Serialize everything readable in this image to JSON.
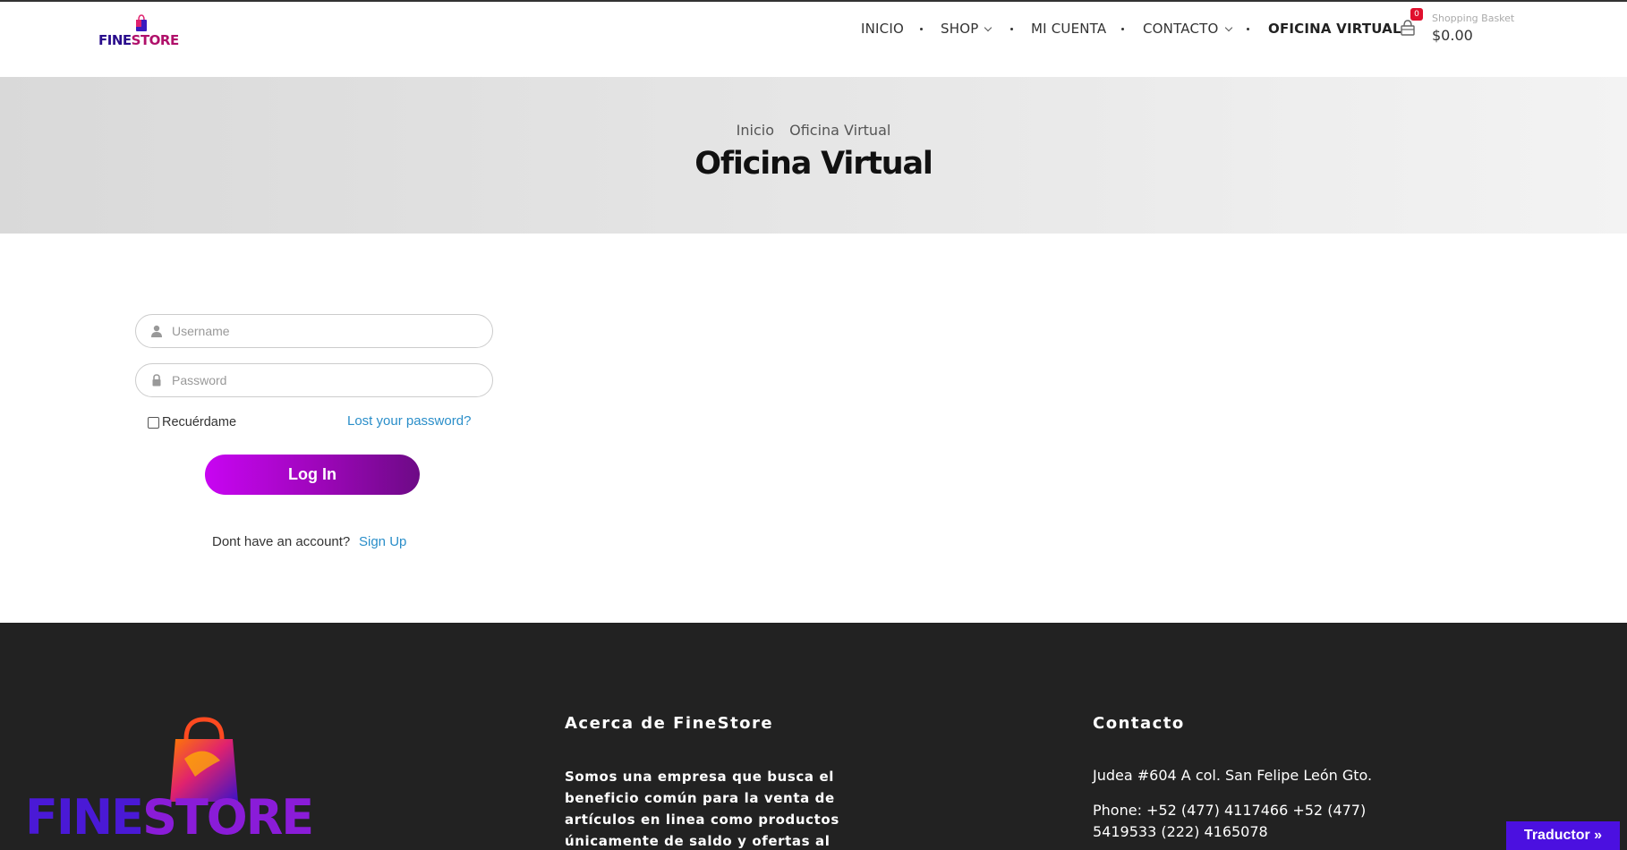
{
  "header": {
    "logo": {
      "word_fine": "FINE",
      "word_store": "STORE"
    },
    "nav": [
      {
        "label": "INICIO"
      },
      {
        "label": "SHOP"
      },
      {
        "label": "MI CUENTA"
      },
      {
        "label": "CONTACTO"
      },
      {
        "label": "OFICINA VIRTUAL"
      }
    ],
    "cart": {
      "count": "0",
      "label": "Shopping Basket",
      "amount": "$0.00",
      "icon": "shopping-basket-icon"
    }
  },
  "hero": {
    "breadcrumb": [
      "Inicio",
      "Oficina Virtual"
    ],
    "title": "Oficina Virtual"
  },
  "login": {
    "username_placeholder": "Username",
    "password_placeholder": "Password",
    "remember_label": "Recuérdame",
    "lost_password": "Lost your password?",
    "submit": "Log In",
    "no_account": "Dont have an account?",
    "signup": "Sign Up"
  },
  "footer": {
    "logo": {
      "word_fine": "FINE",
      "word_store": "STORE"
    },
    "about_heading": "Acerca de FineStore",
    "about_text": "Somos una empresa que busca el beneficio común para la venta de artículos en linea como productos únicamente de saldo y ofertas al mejor",
    "contact_heading": "Contacto",
    "address": "Judea #604 A col. San Felipe León Gto.",
    "phone": "Phone: +52 (477) 4117466 +52 (477) 5419533 (222) 4165078"
  },
  "translator": "Traductor »",
  "colors": {
    "accent_purple": "#9c06b8",
    "link_blue": "#2a8ec9",
    "footer_bg": "#222222",
    "badge_red": "#e00f2d",
    "translator_bg": "#4b10e0"
  }
}
